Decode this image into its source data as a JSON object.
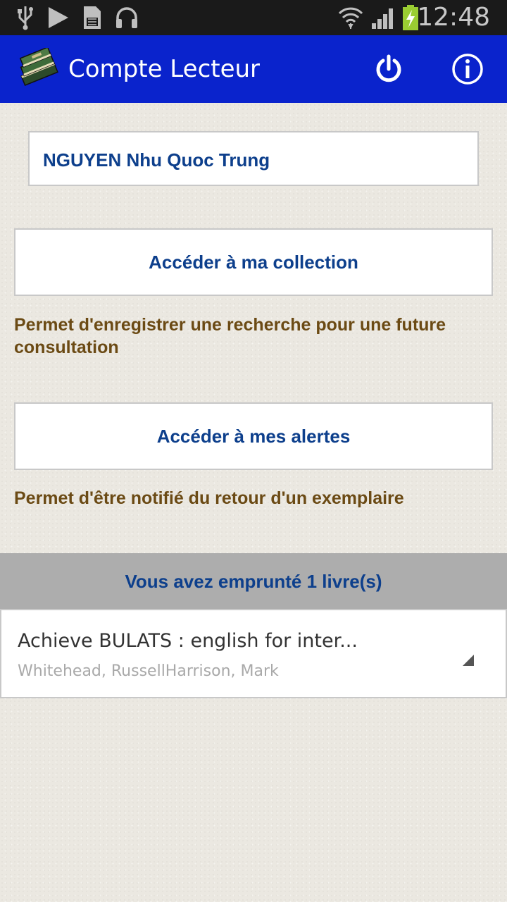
{
  "status_bar": {
    "time": "12:48",
    "icons": [
      "usb-icon",
      "play-icon",
      "sd-card-icon",
      "headphones-icon",
      "wifi-icon",
      "signal-icon",
      "battery-charging-icon"
    ]
  },
  "action_bar": {
    "title": "Compte Lecteur",
    "icons": [
      "books-logo-icon",
      "power-icon",
      "info-icon"
    ]
  },
  "user": {
    "name": "NGUYEN Nhu Quoc Trung"
  },
  "collection": {
    "button_label": "Accéder à ma collection",
    "description": "Permet d'enregistrer une recherche pour une future consultation"
  },
  "alerts": {
    "button_label": "Accéder à mes alertes",
    "description": "Permet d'être notifié du retour d'un exemplaire"
  },
  "loans": {
    "header": "Vous avez emprunté 1 livre(s)",
    "items": [
      {
        "title": "Achieve BULATS : english for inter...",
        "author": "Whitehead, RussellHarrison, Mark"
      }
    ]
  },
  "colors": {
    "action_bar": "#0a23cc",
    "primary_text": "#0d3f8c",
    "description_text": "#6b4a14",
    "loan_header_bg": "#adadad"
  }
}
